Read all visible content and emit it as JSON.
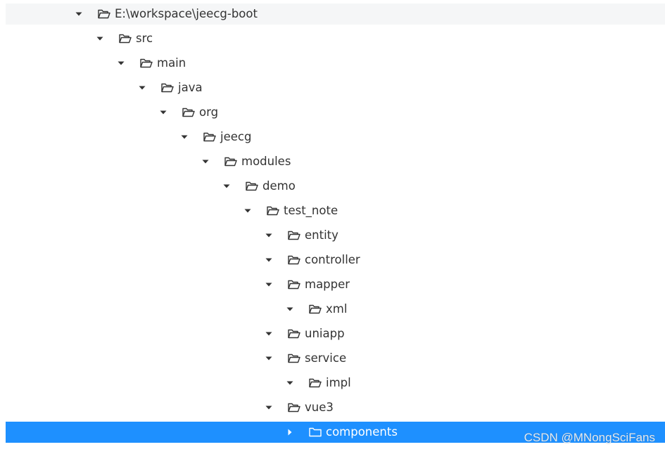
{
  "colors": {
    "selected_background": "#1e90ff",
    "root_background": "#f5f6f7",
    "text": "#333333",
    "selected_text": "#ffffff"
  },
  "tree": {
    "nodes": [
      {
        "label": "E:\\workspace\\jeecg-boot",
        "depth": 0,
        "expanded": true,
        "selected": false,
        "icon": "folder-open-icon"
      },
      {
        "label": "src",
        "depth": 1,
        "expanded": true,
        "selected": false,
        "icon": "folder-open-icon"
      },
      {
        "label": "main",
        "depth": 2,
        "expanded": true,
        "selected": false,
        "icon": "folder-open-icon"
      },
      {
        "label": "java",
        "depth": 3,
        "expanded": true,
        "selected": false,
        "icon": "folder-open-icon"
      },
      {
        "label": "org",
        "depth": 4,
        "expanded": true,
        "selected": false,
        "icon": "folder-open-icon"
      },
      {
        "label": "jeecg",
        "depth": 5,
        "expanded": true,
        "selected": false,
        "icon": "folder-open-icon"
      },
      {
        "label": "modules",
        "depth": 6,
        "expanded": true,
        "selected": false,
        "icon": "folder-open-icon"
      },
      {
        "label": "demo",
        "depth": 7,
        "expanded": true,
        "selected": false,
        "icon": "folder-open-icon"
      },
      {
        "label": "test_note",
        "depth": 8,
        "expanded": true,
        "selected": false,
        "icon": "folder-open-icon"
      },
      {
        "label": "entity",
        "depth": 9,
        "expanded": true,
        "selected": false,
        "icon": "folder-open-icon"
      },
      {
        "label": "controller",
        "depth": 9,
        "expanded": true,
        "selected": false,
        "icon": "folder-open-icon"
      },
      {
        "label": "mapper",
        "depth": 9,
        "expanded": true,
        "selected": false,
        "icon": "folder-open-icon"
      },
      {
        "label": "xml",
        "depth": 10,
        "expanded": true,
        "selected": false,
        "icon": "folder-open-icon"
      },
      {
        "label": "uniapp",
        "depth": 9,
        "expanded": true,
        "selected": false,
        "icon": "folder-open-icon"
      },
      {
        "label": "service",
        "depth": 9,
        "expanded": true,
        "selected": false,
        "icon": "folder-open-icon"
      },
      {
        "label": "impl",
        "depth": 10,
        "expanded": true,
        "selected": false,
        "icon": "folder-open-icon"
      },
      {
        "label": "vue3",
        "depth": 9,
        "expanded": true,
        "selected": false,
        "icon": "folder-open-icon"
      },
      {
        "label": "components",
        "depth": 10,
        "expanded": false,
        "selected": true,
        "icon": "folder-closed-icon"
      }
    ]
  },
  "watermark": "CSDN @MNongSciFans"
}
